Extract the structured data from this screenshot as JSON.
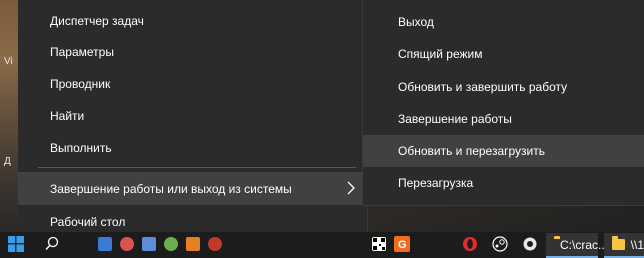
{
  "desktop": {
    "labels": [
      "Vi",
      "Д"
    ]
  },
  "winx_menu": {
    "items": [
      {
        "label": "Диспетчер задач"
      },
      {
        "label": "Параметры"
      },
      {
        "label": "Проводник"
      },
      {
        "label": "Найти"
      },
      {
        "label": "Выполнить"
      },
      {
        "label": "Завершение работы или выход из системы"
      },
      {
        "label": "Рабочий стол"
      }
    ],
    "highlighted_index": 5,
    "submenu_arrow_icon": "chevron-right-icon"
  },
  "submenu": {
    "items": [
      {
        "label": "Выход"
      },
      {
        "label": "Спящий режим"
      },
      {
        "label": "Обновить и завершить работу"
      },
      {
        "label": "Завершение работы"
      },
      {
        "label": "Обновить и перезагрузить"
      },
      {
        "label": "Перезагрузка"
      }
    ],
    "highlighted_index": 4
  },
  "taskbar": {
    "start_icon": "windows-logo-icon",
    "pinned_icons": [
      "search-icon",
      "app-icon",
      "app-icon",
      "app-icon",
      "app-icon",
      "app-icon",
      "app-icon",
      "qr-app-icon",
      "orange-app-icon",
      "opera-icon",
      "steam-icon",
      "gear-app-icon"
    ],
    "windows": [
      {
        "label": "C:\\crac...",
        "icon": "folder-icon"
      },
      {
        "label": "\\\\1",
        "icon": "folder-icon"
      }
    ]
  },
  "colors": {
    "menu_bg": "#2b2b2b",
    "highlight_bg": "#414141",
    "text": "#ffffff",
    "taskbar_bg": "#1c1c1c",
    "accent": "#0078d7"
  }
}
